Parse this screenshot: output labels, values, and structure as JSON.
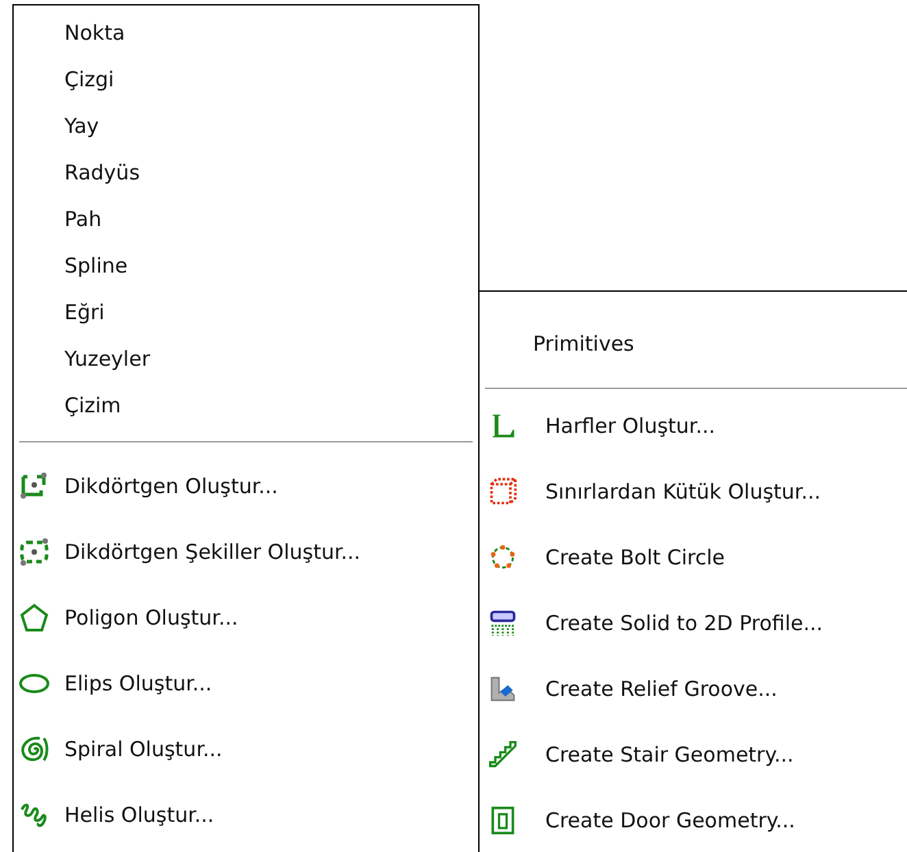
{
  "left_menu": {
    "submenus": [
      {
        "label": "Nokta"
      },
      {
        "label": "Çizgi"
      },
      {
        "label": "Yay"
      },
      {
        "label": "Radyüs"
      },
      {
        "label": "Pah"
      },
      {
        "label": "Spline"
      },
      {
        "label": "Eğri"
      },
      {
        "label": "Yuzeyler"
      },
      {
        "label": "Çizim"
      }
    ],
    "commands": [
      {
        "label": "Dikdörtgen Oluştur..."
      },
      {
        "label": "Dikdörtgen Şekiller Oluştur..."
      },
      {
        "label": "Poligon Oluştur..."
      },
      {
        "label": "Elips Oluştur..."
      },
      {
        "label": "Spiral Oluştur..."
      },
      {
        "label": "Helis Oluştur..."
      }
    ]
  },
  "right_menu": {
    "header": "Primitives",
    "commands": [
      {
        "label": "Harfler Oluştur..."
      },
      {
        "label": "Sınırlardan Kütük Oluştur..."
      },
      {
        "label": "Create Bolt Circle"
      },
      {
        "label": "Create Solid to 2D Profile..."
      },
      {
        "label": "Create Relief Groove..."
      },
      {
        "label": "Create Stair Geometry..."
      },
      {
        "label": "Create Door Geometry..."
      }
    ]
  }
}
